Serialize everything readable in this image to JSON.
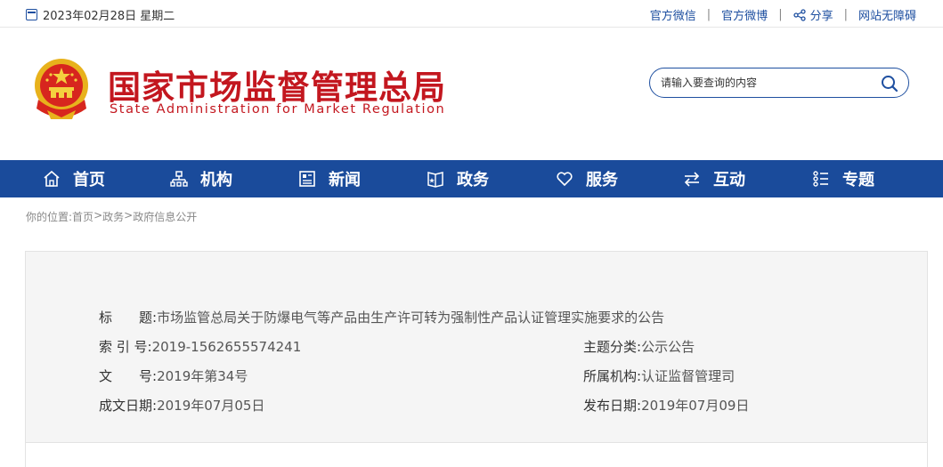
{
  "topbar": {
    "date": "2023年02月28日 星期二",
    "links": {
      "wechat": "官方微信",
      "weibo": "官方微博",
      "share": "分享",
      "accessibility": "网站无障碍"
    },
    "separator": "|"
  },
  "header": {
    "title": "国家市场监督管理总局",
    "subtitle": "State Administration for Market Regulation",
    "search_placeholder": "请输入要查询的内容"
  },
  "nav": {
    "items": [
      {
        "label": "首页",
        "icon": "home-icon"
      },
      {
        "label": "机构",
        "icon": "org-chart-icon"
      },
      {
        "label": "新闻",
        "icon": "newspaper-icon"
      },
      {
        "label": "政务",
        "icon": "book-icon"
      },
      {
        "label": "服务",
        "icon": "heart-icon"
      },
      {
        "label": "互动",
        "icon": "exchange-icon"
      },
      {
        "label": "专题",
        "icon": "list-icon"
      }
    ]
  },
  "breadcrumb": {
    "prefix": "你的位置:",
    "items": [
      "首页",
      "政务",
      "政府信息公开"
    ],
    "separator": ">"
  },
  "info": {
    "title_label": "标　　题:",
    "title_value": "市场监管总局关于防爆电气等产品由生产许可转为强制性产品认证管理实施要求的公告",
    "index_label": "索 引 号:",
    "index_value": "2019-1562655574241",
    "doc_label": "文　　号:",
    "doc_value": "2019年第34号",
    "created_label": "成文日期:",
    "created_value": "2019年07月05日",
    "topic_label": "主题分类:",
    "topic_value": "公示公告",
    "org_label": "所属机构:",
    "org_value": "认证监督管理司",
    "published_label": "发布日期:",
    "published_value": "2019年07月09日"
  },
  "colors": {
    "brand_red": "#c3171f",
    "nav_blue": "#1a4b9b",
    "link_blue": "#1e4fa0"
  }
}
